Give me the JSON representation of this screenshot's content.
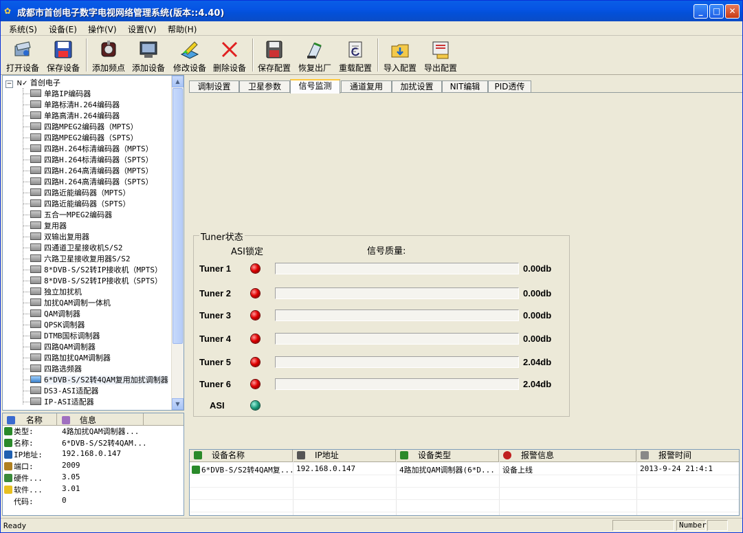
{
  "window": {
    "title": "成都市首创电子数字电视网络管理系统(版本::4.40)"
  },
  "menu": [
    "系统(S)",
    "设备(E)",
    "操作(V)",
    "设置(V)",
    "帮助(H)"
  ],
  "toolbar": {
    "buttons": [
      {
        "label": "打开设备",
        "icon": "open-device-icon"
      },
      {
        "label": "保存设备",
        "icon": "save-device-icon"
      },
      {
        "label": "添加频点",
        "icon": "add-frequency-icon"
      },
      {
        "label": "添加设备",
        "icon": "add-device-icon"
      },
      {
        "label": "修改设备",
        "icon": "edit-device-icon"
      },
      {
        "label": "删除设备",
        "icon": "delete-icon"
      },
      {
        "label": "保存配置",
        "icon": "save-config-icon"
      },
      {
        "label": "恢复出厂",
        "icon": "factory-reset-icon"
      },
      {
        "label": "重载配置",
        "icon": "reload-config-icon"
      },
      {
        "label": "导入配置",
        "icon": "import-config-icon"
      },
      {
        "label": "导出配置",
        "icon": "export-config-icon"
      }
    ]
  },
  "tree": {
    "root": "首创电子",
    "items": [
      "单路IP编码器",
      "单路标清H.264编码器",
      "单路高清H.264编码器",
      "四路MPEG2编码器（MPTS）",
      "四路MPEG2编码器（SPTS）",
      "四路H.264标清编码器（MPTS）",
      "四路H.264标清编码器（SPTS）",
      "四路H.264高清编码器（MPTS）",
      "四路H.264高清编码器（SPTS）",
      "四路近能编码器（MPTS）",
      "四路近能编码器（SPTS）",
      "五合一MPEG2编码器",
      "复用器",
      "双输出复用器",
      "四通道卫星接收机S/S2",
      "六路卫星接收复用器S/S2",
      "8*DVB-S/S2转IP接收机（MPTS）",
      "8*DVB-S/S2转IP接收机（SPTS）",
      "独立加扰机",
      "加扰QAM调制一体机",
      "QAM调制器",
      "QPSK调制器",
      "DTMB国标调制器",
      "四路QAM调制器",
      "四路加扰QAM调制器",
      "四路选频器",
      "6*DVB-S/S2转4QAM复用加扰调制器",
      "DS3-ASI适配器",
      "IP-ASI适配器"
    ],
    "selected_index": 26
  },
  "info": {
    "headers": [
      "名称",
      "信息"
    ],
    "rows": [
      {
        "key": "类型:",
        "value": "4路加扰QAM调制器..."
      },
      {
        "key": "名称:",
        "value": "6*DVB-S/S2转4QAM..."
      },
      {
        "key": "IP地址:",
        "value": "192.168.0.147"
      },
      {
        "key": "端口:",
        "value": "2009"
      },
      {
        "key": "硬件...",
        "value": "3.05"
      },
      {
        "key": "软件...",
        "value": "3.01"
      },
      {
        "key": "代码:",
        "value": "0"
      }
    ]
  },
  "tabs": [
    "调制设置",
    "卫星参数",
    "信号监测",
    "通道复用",
    "加扰设置",
    "NIT编辑",
    "PID透传"
  ],
  "active_tab": 2,
  "tuner": {
    "group_title": "Tuner状态",
    "col_lock": "ASI锁定",
    "col_quality": "信号质量:",
    "rows": [
      {
        "label": "Tuner 1",
        "led": "red",
        "quality": 0,
        "db": "0.00db"
      },
      {
        "label": "Tuner 2",
        "led": "red",
        "quality": 0,
        "db": "0.00db"
      },
      {
        "label": "Tuner 3",
        "led": "red",
        "quality": 0,
        "db": "0.00db"
      },
      {
        "label": "Tuner 4",
        "led": "red",
        "quality": 0,
        "db": "0.00db"
      },
      {
        "label": "Tuner 5",
        "led": "red",
        "quality": 0,
        "db": "2.04db"
      },
      {
        "label": "Tuner 6",
        "led": "red",
        "quality": 0,
        "db": "2.04db"
      }
    ],
    "asi": {
      "label": "ASI",
      "led": "green"
    }
  },
  "alarm": {
    "headers": [
      "设备名称",
      "IP地址",
      "设备类型",
      "报警信息",
      "报警时间"
    ],
    "rows": [
      [
        "6*DVB-S/S2转4QAM复...",
        "192.168.0.147",
        "4路加扰QAM调制器(6*D...",
        "设备上线",
        "2013-9-24 21:4:1"
      ]
    ]
  },
  "status": {
    "text": "Ready",
    "pane": "Number"
  },
  "colors": {
    "titlebar": "#0a5ee6",
    "led_red": "#e00000",
    "led_green": "#1a9a7a",
    "active_tab_accent": "#ffc83c"
  }
}
